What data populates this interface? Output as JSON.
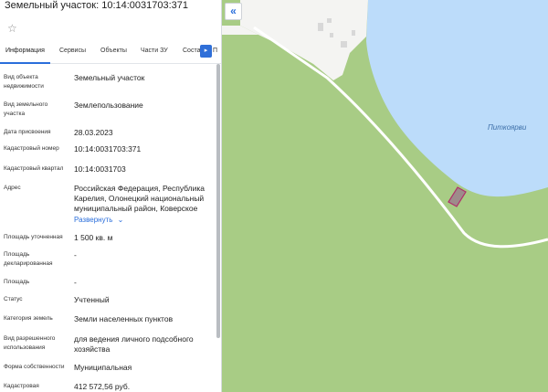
{
  "header": {
    "title": "Земельный участок: 10:14:0031703:371"
  },
  "tabs": [
    {
      "label": "Информация"
    },
    {
      "label": "Сервисы"
    },
    {
      "label": "Объекты"
    },
    {
      "label": "Части ЗУ"
    },
    {
      "label": "Соста"
    }
  ],
  "tab_more_label": "П",
  "fields": [
    {
      "label": "Вид объекта недвижимости",
      "value": "Земельный участок"
    },
    {
      "label": "Вид земельного участка",
      "value": "Землепользование"
    },
    {
      "label": "Дата присвоения",
      "value": "28.03.2023"
    },
    {
      "label": "Кадастровый номер",
      "value": "10:14:0031703:371"
    },
    {
      "label": "Кадастровый квартал",
      "value": "10:14:0031703"
    },
    {
      "label": "Адрес",
      "value": "Российская Федерация, Республика Карелия, Олонецкий национальный муниципальный район, Коверское"
    },
    {
      "label": "Площадь уточненная",
      "value": "1 500 кв. м"
    },
    {
      "label": "Площадь декларированная",
      "value": "-"
    },
    {
      "label": "Площадь",
      "value": "-"
    },
    {
      "label": "Статус",
      "value": "Учтенный"
    },
    {
      "label": "Категория земель",
      "value": "Земли населенных пунктов"
    },
    {
      "label": "Вид разрешенного использования",
      "value": "для ведения личного подсобного хозяйства"
    },
    {
      "label": "Форма собственности",
      "value": "Муниципальная"
    },
    {
      "label": "Кадастровая",
      "value": "412 572,56 руб."
    }
  ],
  "expand_label": "Развернуть",
  "map": {
    "lake_label": "Питкоярви",
    "colors": {
      "land": "#a8cc85",
      "water": "#bcdcfa",
      "road": "#ffffff",
      "parcel_fill": "#9e8b8b",
      "parcel_stroke": "#b0306a"
    }
  }
}
